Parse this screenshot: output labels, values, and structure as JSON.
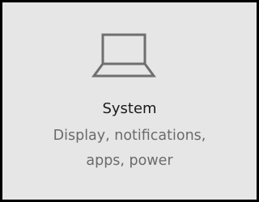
{
  "tile": {
    "icon": "laptop-icon",
    "title": "System",
    "description_lines": [
      "Display, notifications,",
      "apps, power"
    ]
  },
  "colors": {
    "tile_background": "#e6e6e6",
    "tile_border": "#000000",
    "title_text": "#1a1a1a",
    "description_text": "#6b6b6b",
    "icon_stroke": "#6f6f6f"
  }
}
